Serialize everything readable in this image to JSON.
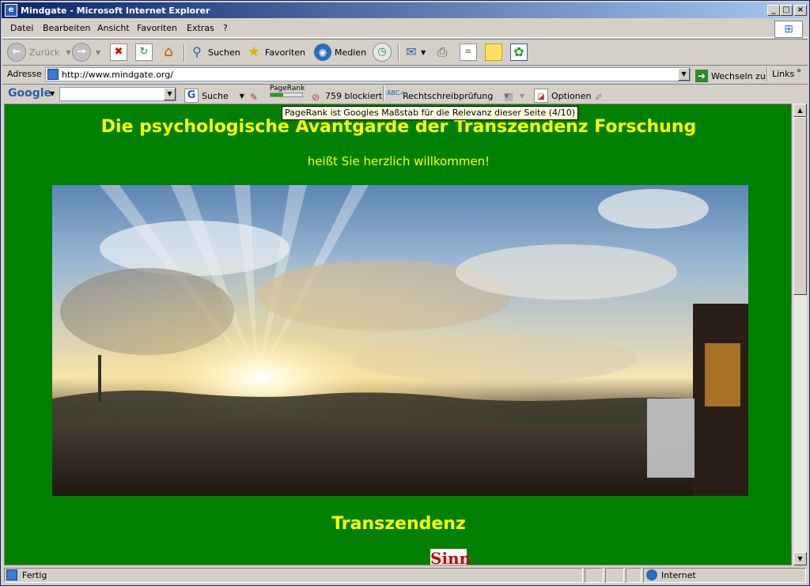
{
  "window": {
    "title": "Mindgate - Microsoft Internet Explorer",
    "app_icon": "ie-icon"
  },
  "menu": {
    "items": [
      "Datei",
      "Bearbeiten",
      "Ansicht",
      "Favoriten",
      "Extras",
      "?"
    ]
  },
  "toolbar": {
    "back_label": "Zurück",
    "search_label": "Suchen",
    "favorites_label": "Favoriten",
    "media_label": "Medien"
  },
  "address": {
    "label": "Adresse",
    "url": "http://www.mindgate.org/",
    "go_label": "Wechseln zu",
    "links_label": "Links"
  },
  "google_toolbar": {
    "logo": "Google",
    "search_button": "Suche",
    "pagerank_label": "PageRank",
    "blocked_label": "759 blockiert",
    "spellcheck_label": "Rechtschreibprüfung",
    "options_label": "Optionen",
    "pagerank_tooltip": "PageRank ist Googles Maßstab für die Relevanz dieser Seite (4/10)",
    "pagerank_value": 0.4
  },
  "page": {
    "heading": "Die psychologische Avantgarde der Transzendenz Forschung",
    "welcome": "heißt Sie herzlich willkommen!",
    "section_heading": "Transzendenz",
    "sinn_box": "Sinn"
  },
  "status": {
    "text": "Fertig",
    "zone": "Internet"
  },
  "colors": {
    "page_bg": "#008000",
    "heading_color": "#ffff00",
    "sinn_color": "#cc0000"
  }
}
